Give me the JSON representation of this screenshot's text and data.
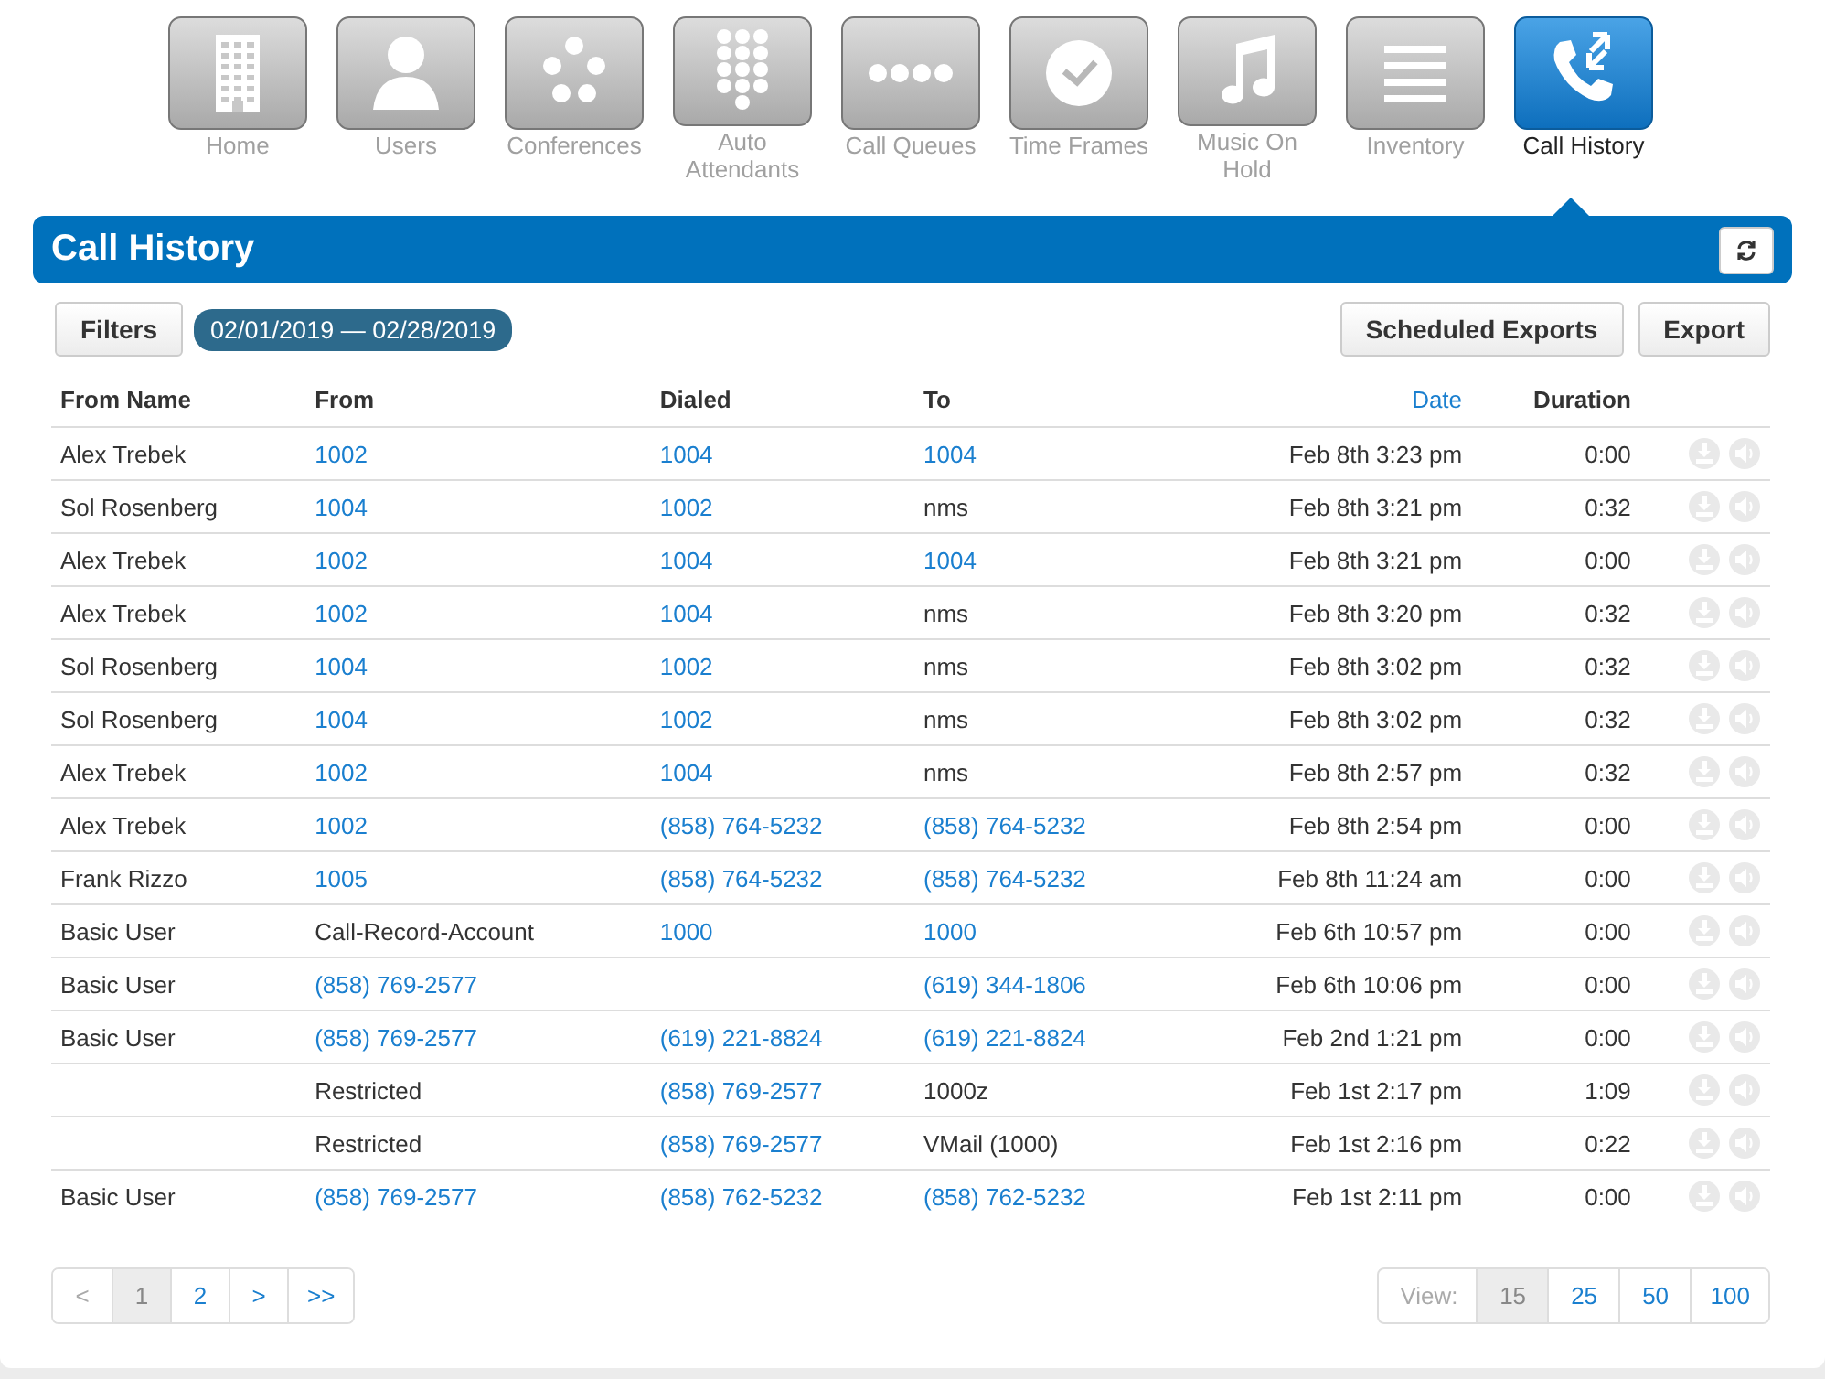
{
  "nav": [
    {
      "label": "Home",
      "selected": false
    },
    {
      "label": "Users",
      "selected": false
    },
    {
      "label": "Conferences",
      "selected": false
    },
    {
      "label": "Auto Attendants",
      "selected": false
    },
    {
      "label": "Call Queues",
      "selected": false
    },
    {
      "label": "Time Frames",
      "selected": false
    },
    {
      "label": "Music On Hold",
      "selected": false
    },
    {
      "label": "Inventory",
      "selected": false
    },
    {
      "label": "Call History",
      "selected": true
    }
  ],
  "header": {
    "title": "Call History"
  },
  "toolbar": {
    "filters": "Filters",
    "date_range": "02/01/2019 — 02/28/2019",
    "buttons": [
      "Scheduled Exports",
      "Export"
    ]
  },
  "table": {
    "columns": [
      {
        "label": "From Name",
        "sorted": false
      },
      {
        "label": "From",
        "sorted": false
      },
      {
        "label": "Dialed",
        "sorted": false
      },
      {
        "label": "To",
        "sorted": false
      },
      {
        "label": "Date",
        "sorted": true
      },
      {
        "label": "Duration",
        "sorted": false
      }
    ],
    "rows": [
      {
        "from_name": "Alex Trebek",
        "from": {
          "text": "1002",
          "link": true
        },
        "dialed": {
          "text": "1004",
          "link": true
        },
        "to": {
          "text": "1004",
          "link": true
        },
        "date": "Feb 8th 3:23 pm",
        "duration": "0:00"
      },
      {
        "from_name": "Sol Rosenberg",
        "from": {
          "text": "1004",
          "link": true
        },
        "dialed": {
          "text": "1002",
          "link": true
        },
        "to": {
          "text": "nms",
          "link": false
        },
        "date": "Feb 8th 3:21 pm",
        "duration": "0:32"
      },
      {
        "from_name": "Alex Trebek",
        "from": {
          "text": "1002",
          "link": true
        },
        "dialed": {
          "text": "1004",
          "link": true
        },
        "to": {
          "text": "1004",
          "link": true
        },
        "date": "Feb 8th 3:21 pm",
        "duration": "0:00"
      },
      {
        "from_name": "Alex Trebek",
        "from": {
          "text": "1002",
          "link": true
        },
        "dialed": {
          "text": "1004",
          "link": true
        },
        "to": {
          "text": "nms",
          "link": false
        },
        "date": "Feb 8th 3:20 pm",
        "duration": "0:32"
      },
      {
        "from_name": "Sol Rosenberg",
        "from": {
          "text": "1004",
          "link": true
        },
        "dialed": {
          "text": "1002",
          "link": true
        },
        "to": {
          "text": "nms",
          "link": false
        },
        "date": "Feb 8th 3:02 pm",
        "duration": "0:32"
      },
      {
        "from_name": "Sol Rosenberg",
        "from": {
          "text": "1004",
          "link": true
        },
        "dialed": {
          "text": "1002",
          "link": true
        },
        "to": {
          "text": "nms",
          "link": false
        },
        "date": "Feb 8th 3:02 pm",
        "duration": "0:32"
      },
      {
        "from_name": "Alex Trebek",
        "from": {
          "text": "1002",
          "link": true
        },
        "dialed": {
          "text": "1004",
          "link": true
        },
        "to": {
          "text": "nms",
          "link": false
        },
        "date": "Feb 8th 2:57 pm",
        "duration": "0:32"
      },
      {
        "from_name": "Alex Trebek",
        "from": {
          "text": "1002",
          "link": true
        },
        "dialed": {
          "text": "(858) 764-5232",
          "link": true
        },
        "to": {
          "text": "(858) 764-5232",
          "link": true
        },
        "date": "Feb 8th 2:54 pm",
        "duration": "0:00"
      },
      {
        "from_name": "Frank Rizzo",
        "from": {
          "text": "1005",
          "link": true
        },
        "dialed": {
          "text": "(858) 764-5232",
          "link": true
        },
        "to": {
          "text": "(858) 764-5232",
          "link": true
        },
        "date": "Feb 8th 11:24 am",
        "duration": "0:00"
      },
      {
        "from_name": "Basic User",
        "from": {
          "text": "Call-Record-Account",
          "link": false
        },
        "dialed": {
          "text": "1000",
          "link": true
        },
        "to": {
          "text": "1000",
          "link": true
        },
        "date": "Feb 6th 10:57 pm",
        "duration": "0:00"
      },
      {
        "from_name": "Basic User",
        "from": {
          "text": "(858) 769-2577",
          "link": true
        },
        "to": {
          "text": "(619) 344-1806",
          "link": true
        },
        "date": "Feb 6th 10:06 pm",
        "duration": "0:00"
      },
      {
        "from_name": "Basic User",
        "from": {
          "text": "(858) 769-2577",
          "link": true
        },
        "dialed": {
          "text": "(619) 221-8824",
          "link": true
        },
        "to": {
          "text": "(619) 221-8824",
          "link": true
        },
        "date": "Feb 2nd 1:21 pm",
        "duration": "0:00"
      },
      {
        "from": {
          "text": "Restricted",
          "link": false
        },
        "dialed": {
          "text": "(858) 769-2577",
          "link": true
        },
        "to": {
          "text": "1000z",
          "link": false
        },
        "date": "Feb 1st 2:17 pm",
        "duration": "1:09"
      },
      {
        "from": {
          "text": "Restricted",
          "link": false
        },
        "dialed": {
          "text": "(858) 769-2577",
          "link": true
        },
        "to": {
          "text": "VMail (1000)",
          "link": false
        },
        "date": "Feb 1st 2:16 pm",
        "duration": "0:22"
      },
      {
        "from_name": "Basic User",
        "from": {
          "text": "(858) 769-2577",
          "link": true
        },
        "dialed": {
          "text": "(858) 762-5232",
          "link": true
        },
        "to": {
          "text": "(858) 762-5232",
          "link": true
        },
        "date": "Feb 1st 2:11 pm",
        "duration": "0:00"
      }
    ]
  },
  "pagination": [
    {
      "label": "<",
      "selected": false,
      "disabled": true
    },
    {
      "label": "1",
      "selected": true,
      "disabled": false
    },
    {
      "label": "2",
      "selected": false,
      "disabled": false
    },
    {
      "label": ">",
      "selected": false,
      "disabled": false
    },
    {
      "label": ">>",
      "selected": false,
      "disabled": false
    }
  ],
  "view": {
    "label": "View:",
    "options": [
      {
        "label": "15",
        "selected": true
      },
      {
        "label": "25",
        "selected": false
      },
      {
        "label": "50",
        "selected": false
      },
      {
        "label": "100",
        "selected": false
      }
    ]
  }
}
